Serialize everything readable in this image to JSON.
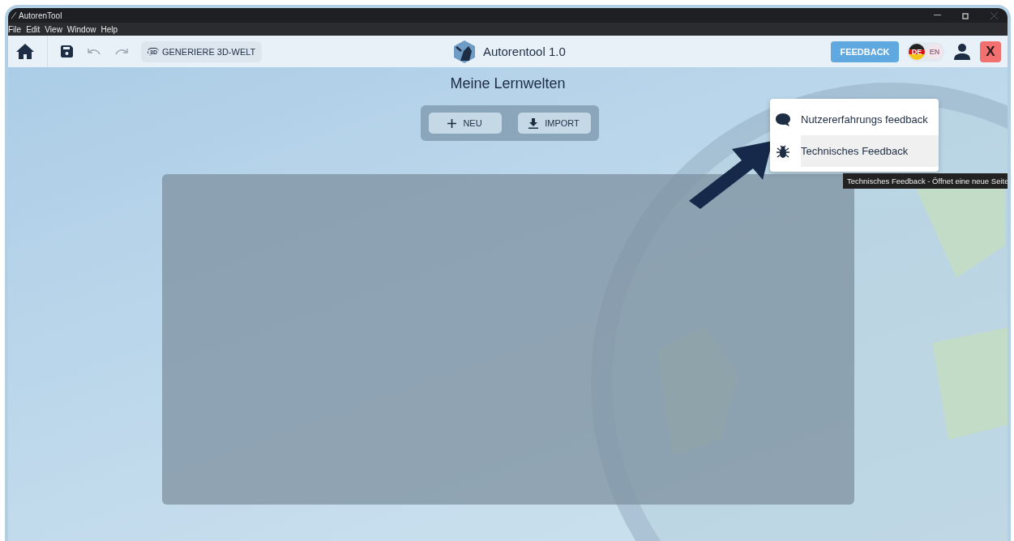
{
  "window": {
    "title": "AutorenTool"
  },
  "menu": [
    "File",
    "Edit",
    "View",
    "Window",
    "Help"
  ],
  "toolbar": {
    "undo": {
      "disabled": true
    },
    "redo": {
      "disabled": true
    },
    "generate_button": {
      "icon_text": "3D",
      "label": "GENERIERE 3D-WELT"
    },
    "app_title": "Autorentool 1.0",
    "feedback_button": "FEEDBACK",
    "languages": [
      {
        "label": "DE",
        "selected": true
      },
      {
        "label": "EN",
        "selected": false
      }
    ],
    "close_button": "X"
  },
  "heading": "Meine Lernwelten",
  "actions": [
    {
      "kind": "add",
      "label": "NEU"
    },
    {
      "kind": "import",
      "label": "IMPORT"
    }
  ],
  "feedback_menu": [
    {
      "kind": "chat",
      "label": "Nutzererfahrungs feedback",
      "selected": false
    },
    {
      "kind": "bug",
      "label": "Technisches Feedback",
      "selected": true
    }
  ],
  "tooltip": "Technisches Feedback - Öffnet eine neue Seite"
}
